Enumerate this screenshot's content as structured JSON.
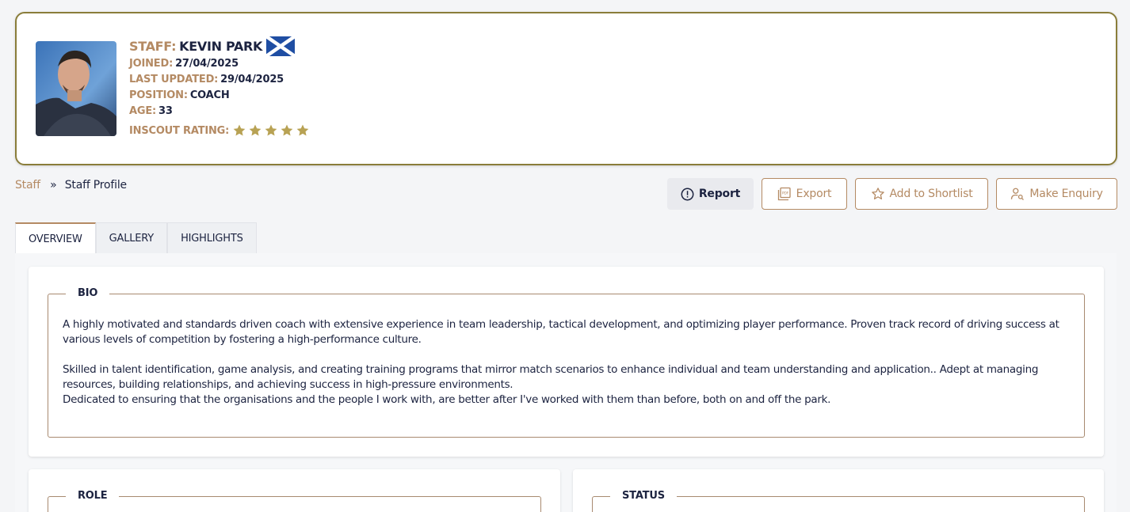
{
  "profile": {
    "staff_label": "STAFF:",
    "name": "KEVIN PARK",
    "flag_icon": "scotland-flag-icon",
    "joined_label": "JOINED:",
    "joined": "27/04/2025",
    "updated_label": "LAST UPDATED:",
    "updated": "29/04/2025",
    "position_label": "POSITION:",
    "position": "COACH",
    "age_label": "AGE:",
    "age": "33",
    "rating_label": "INSCOUT RATING:",
    "rating": 5,
    "rating_max": 5
  },
  "breadcrumb": {
    "link": "Staff",
    "separator": "»",
    "current": "Staff Profile"
  },
  "actions": {
    "report": "Report",
    "export": "Export",
    "shortlist": "Add to Shortlist",
    "enquiry": "Make Enquiry"
  },
  "tabs": [
    {
      "label": "OVERVIEW",
      "active": true
    },
    {
      "label": "GALLERY",
      "active": false
    },
    {
      "label": "HIGHLIGHTS",
      "active": false
    }
  ],
  "bio": {
    "title": "BIO",
    "p1": "A highly motivated and standards driven coach with extensive experience in team leadership, tactical development, and optimizing player performance. Proven track record of driving success at various levels of competition by fostering a high-performance culture.",
    "p2": "Skilled in talent identification, game analysis, and creating training programs that mirror match scenarios to enhance individual and team understanding and application.. Adept at managing resources, building relationships, and achieving success in high-pressure environments.",
    "p3": "Dedicated to ensuring that the organisations and the people I work with, are better after I've worked with them than before, both on and off the park."
  },
  "role": {
    "title": "ROLE"
  },
  "status": {
    "title": "STATUS"
  },
  "colors": {
    "accent": "#b48a63",
    "navy": "#1c2340",
    "gold": "#b8a254",
    "card_border": "#8a7d3a"
  }
}
